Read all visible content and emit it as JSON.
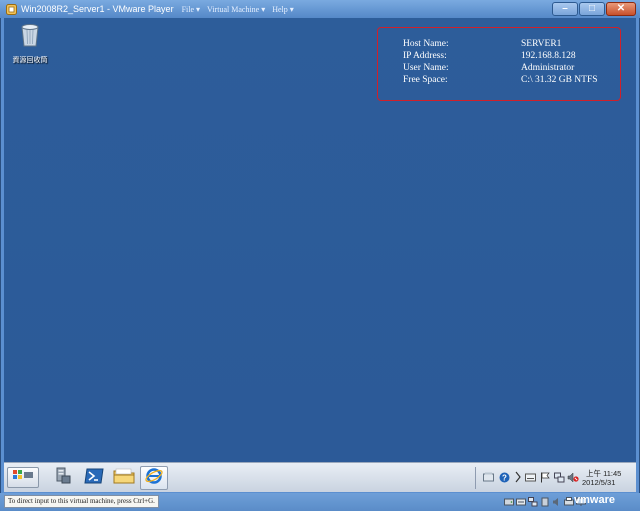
{
  "window": {
    "title": "Win2008R2_Server1 - VMware Player",
    "menu": [
      {
        "label": "File"
      },
      {
        "label": "Virtual Machine"
      },
      {
        "label": "Help"
      }
    ],
    "menu_arrow": "▾",
    "controls": {
      "minimize": "–",
      "maximize": "□",
      "close": "✕"
    }
  },
  "desktop": {
    "recycle_bin_label": "資源回收筒",
    "background_color": "#2c5b99",
    "bginfo": {
      "border_color": "#d0202a",
      "rows": [
        {
          "label": "Host Name:",
          "value": "SERVER1"
        },
        {
          "label": "IP Address:",
          "value": "192.168.8.128"
        },
        {
          "label": "User Name:",
          "value": "Administrator"
        },
        {
          "label": "Free Space:",
          "value": "C:\\ 31.32 GB NTFS"
        }
      ]
    }
  },
  "taskbar": {
    "start_icon": "windows-logo-icon",
    "pinned": [
      {
        "name": "server-manager-icon"
      },
      {
        "name": "powershell-icon"
      },
      {
        "name": "explorer-folder-icon"
      },
      {
        "name": "internet-explorer-icon"
      }
    ],
    "clock": {
      "time": "上午 11:45",
      "date": "2012/5/31"
    }
  },
  "status_bar": {
    "message": "To direct input to this virtual machine, press Ctrl+G.",
    "brand": "vmware"
  }
}
